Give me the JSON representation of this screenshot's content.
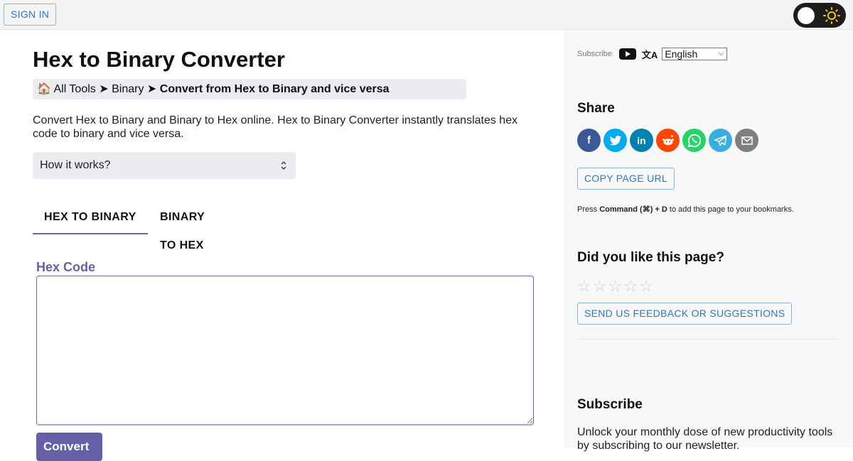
{
  "topbar": {
    "sign_in_label": "SIGN IN",
    "theme_toggle": {
      "mode": "light",
      "icon": "sun-icon",
      "icon_color": "#f5c518"
    }
  },
  "main": {
    "title": "Hex to Binary Converter",
    "breadcrumb": {
      "home_icon": "🏠",
      "items": [
        "All Tools",
        "Binary"
      ],
      "separator": "➤",
      "current": "Convert from Hex to Binary and vice versa"
    },
    "description": "Convert Hex to Binary and Binary to Hex online. Hex to Binary Converter instantly translates hex code to binary and vice versa.",
    "how_it_works": {
      "label": "How it works?",
      "icon": "⌃⌄"
    },
    "tabs": [
      {
        "label": "HEX TO BINARY",
        "active": true
      },
      {
        "label": "BINARY TO HEX",
        "active": false
      }
    ],
    "input": {
      "label": "Hex Code",
      "value": "",
      "placeholder": ""
    },
    "convert_label": "Convert",
    "accent_color": "#6660a8"
  },
  "sidebar": {
    "subscribe_small": "Subscribe",
    "translate_icon": "文A",
    "language": {
      "selected": "English"
    },
    "share": {
      "heading": "Share",
      "networks": [
        {
          "name": "facebook",
          "glyph": "f",
          "color": "#3b5998"
        },
        {
          "name": "twitter",
          "glyph": "🐦",
          "color": "#00aced"
        },
        {
          "name": "linkedin",
          "glyph": "in",
          "color": "#007fb1"
        },
        {
          "name": "reddit",
          "glyph": "👽",
          "color": "#ff4500"
        },
        {
          "name": "whatsapp",
          "glyph": "✆",
          "color": "#25d366"
        },
        {
          "name": "telegram",
          "glyph": "➤",
          "color": "#37aee2"
        },
        {
          "name": "email",
          "glyph": "✉",
          "color": "#7f7f7f"
        }
      ],
      "copy_url_label": "COPY PAGE URL",
      "bookmark_hint": {
        "prefix": "Press ",
        "keys": "Command (⌘) + D",
        "suffix": " to add this page to your bookmarks."
      }
    },
    "rating": {
      "heading": "Did you like this page?",
      "max": 5,
      "value": 0,
      "feedback_label": "SEND US FEEDBACK OR SUGGESTIONS"
    },
    "subscribe": {
      "heading": "Subscribe",
      "text": "Unlock your monthly dose of new productivity tools by subscribing to our newsletter."
    }
  }
}
